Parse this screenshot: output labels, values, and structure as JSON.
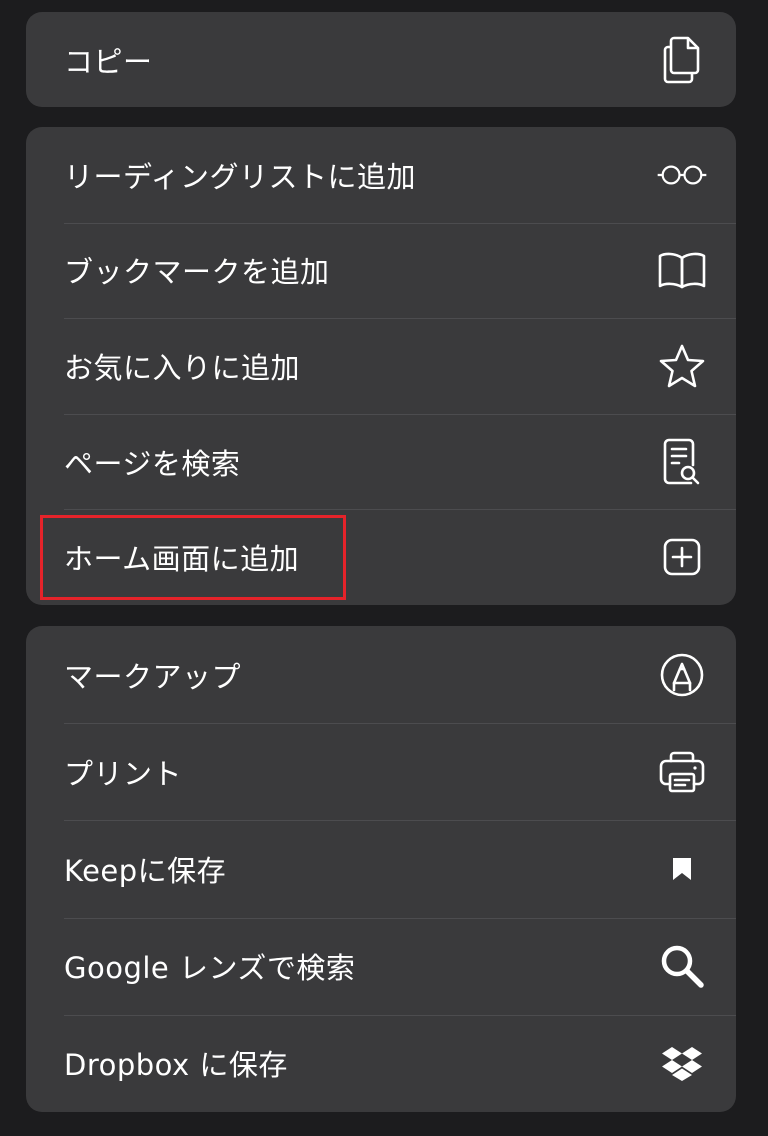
{
  "groups": {
    "copy": {
      "items": [
        {
          "label": "コピー",
          "icon": "copy-icon"
        }
      ]
    },
    "main": {
      "items": [
        {
          "label": "リーディングリストに追加",
          "icon": "glasses-icon"
        },
        {
          "label": "ブックマークを追加",
          "icon": "book-icon"
        },
        {
          "label": "お気に入りに追加",
          "icon": "star-icon"
        },
        {
          "label": "ページを検索",
          "icon": "find-in-page-icon"
        },
        {
          "label": "ホーム画面に追加",
          "icon": "add-square-icon"
        }
      ]
    },
    "tools": {
      "items": [
        {
          "label": "マークアップ",
          "icon": "markup-icon"
        },
        {
          "label": "プリント",
          "icon": "printer-icon"
        },
        {
          "label": "Keepに保存",
          "icon": "bookmark-icon"
        },
        {
          "label": "Google レンズで検索",
          "icon": "search-icon"
        },
        {
          "label": "Dropbox に保存",
          "icon": "dropbox-icon"
        }
      ]
    }
  },
  "highlight": {
    "target": "ホーム画面に追加",
    "color": "#e5232a"
  },
  "colors": {
    "background": "#1c1c1e",
    "card": "#3a3a3c",
    "separator": "#4c4c4f",
    "text": "#ffffff"
  }
}
